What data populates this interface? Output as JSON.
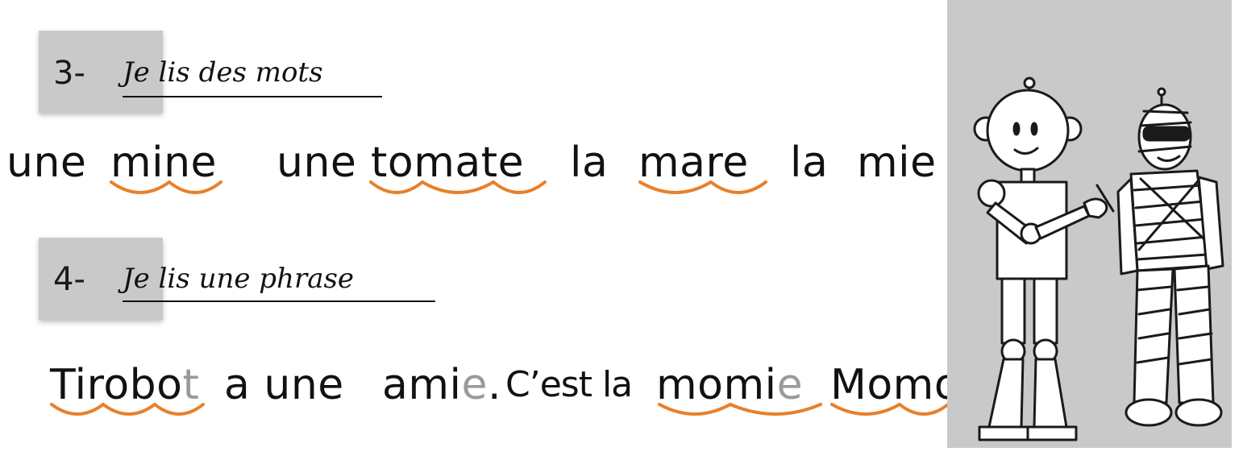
{
  "section3": {
    "number": "3-",
    "title": "Je lis des mots"
  },
  "words": [
    {
      "article": "une",
      "word": "mine"
    },
    {
      "article": "une",
      "word": "tomate"
    },
    {
      "article": "la",
      "word": "mare"
    },
    {
      "article": "la",
      "word": "mie"
    }
  ],
  "section4": {
    "number": "4-",
    "title": "Je lis une phrase"
  },
  "sentence": {
    "w1_main": "Tirobo",
    "w1_silent": "t",
    "w2": "a une",
    "w3_main": "ami",
    "w3_silent": "e",
    "w3_punct": ".",
    "w4": "C’est la",
    "w5_main": "momi",
    "w5_silent": "e",
    "w6": "Momo."
  },
  "colors": {
    "accent": "#e8802a",
    "box": "#c9c9c9",
    "muted": "#9a9a9a"
  },
  "illustration": {
    "description_icon": "robot-and-mummy-illustration"
  }
}
